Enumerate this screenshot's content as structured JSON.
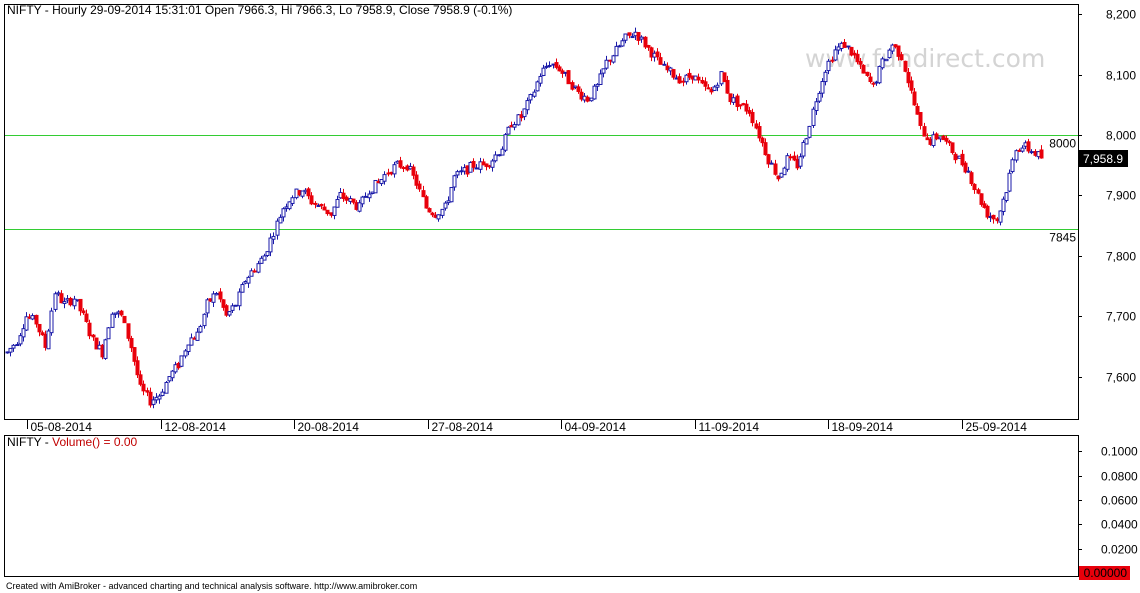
{
  "header": {
    "main_title": "NIFTY - Hourly 29-09-2014 15:31:01 Open 7966.3, Hi 7966.3, Lo 7958.9, Close 7958.9 (-0.1%)",
    "volume_symbol": "NIFTY - ",
    "volume_label": "Volume() = 0.00"
  },
  "watermark": "www.fundirect.com",
  "footer": "Created with AmiBroker - advanced charting and technical analysis software. http://www.amibroker.com",
  "colors": {
    "up": "#1a1aa8",
    "down": "#e8000b",
    "level_line": "#33cc33",
    "level_text": "#33cc33",
    "last_price_bg": "#000000",
    "last_price_text": "#ffffff",
    "volume_badge_bg": "#e8000b"
  },
  "chart_data": [
    {
      "type": "candlestick",
      "title": "NIFTY - Hourly",
      "ylim": [
        7530,
        8215
      ],
      "y_ticks": [
        "8,200",
        "8,100",
        "8,000",
        "7,900",
        "7,800",
        "7,700",
        "7,600"
      ],
      "y_tick_values": [
        8200,
        8100,
        8000,
        7900,
        7800,
        7700,
        7600
      ],
      "x_labels": [
        "05-08-2014",
        "12-08-2014",
        "20-08-2014",
        "27-08-2014",
        "04-09-2014",
        "11-09-2014",
        "18-09-2014",
        "25-09-2014"
      ],
      "horizontal_levels": [
        {
          "value": 8000,
          "label": "8000"
        },
        {
          "value": 7845,
          "label": "7845"
        }
      ],
      "last_price": 7958.9,
      "last_price_label": "7,958.9",
      "close_path": [
        7640,
        7660,
        7700,
        7690,
        7650,
        7740,
        7720,
        7730,
        7700,
        7660,
        7640,
        7710,
        7700,
        7650,
        7580,
        7560,
        7570,
        7600,
        7620,
        7660,
        7670,
        7720,
        7740,
        7700,
        7720,
        7760,
        7780,
        7800,
        7840,
        7880,
        7900,
        7910,
        7890,
        7880,
        7870,
        7900,
        7890,
        7880,
        7910,
        7920,
        7940,
        7950,
        7950,
        7920,
        7880,
        7870,
        7880,
        7930,
        7940,
        7950,
        7950,
        7960,
        7980,
        8020,
        8030,
        8060,
        8100,
        8120,
        8110,
        8090,
        8070,
        8060,
        8080,
        8120,
        8140,
        8160,
        8170,
        8150,
        8130,
        8110,
        8100,
        8090,
        8100,
        8080,
        8070,
        8100,
        8060,
        8050,
        8040,
        8000,
        7960,
        7930,
        7960,
        7950,
        8000,
        8060,
        8110,
        8140,
        8150,
        8130,
        8100,
        8080,
        8120,
        8150,
        8130,
        8070,
        8010,
        7990,
        8000,
        7980,
        7960,
        7940,
        7900,
        7870,
        7860,
        7910,
        7980,
        7980,
        7970,
        7959
      ]
    },
    {
      "type": "bar",
      "title": "NIFTY - Volume()",
      "ylim": [
        0,
        0.11
      ],
      "y_ticks": [
        "0.1000",
        "0.0800",
        "0.0600",
        "0.0400",
        "0.0200",
        "0"
      ],
      "y_tick_values": [
        0.1,
        0.08,
        0.06,
        0.04,
        0.02,
        0
      ],
      "values": [],
      "last_value_label": "0.00000"
    }
  ]
}
